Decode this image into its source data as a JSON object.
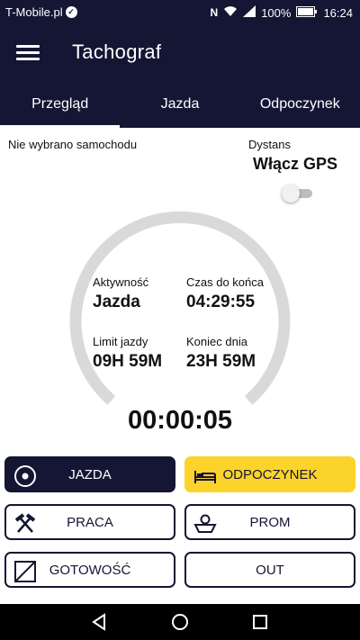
{
  "status_bar": {
    "carrier": "T-Mobile.pl",
    "battery": "100%",
    "time": "16:24"
  },
  "app": {
    "title": "Tachograf"
  },
  "tabs": [
    {
      "label": "Przegląd",
      "active": true
    },
    {
      "label": "Jazda",
      "active": false
    },
    {
      "label": "Odpoczynek",
      "active": false
    }
  ],
  "overview": {
    "vehicle_status": "Nie wybrano samochodu",
    "distance_label": "Dystans",
    "gps_label": "Włącz GPS",
    "gps_enabled": false
  },
  "stats": {
    "activity_label": "Aktywność",
    "activity_value": "Jazda",
    "remaining_label": "Czas do końca",
    "remaining_value": "04:29:55",
    "drive_limit_label": "Limit jazdy",
    "drive_limit_value": "09H 59M",
    "day_end_label": "Koniec dnia",
    "day_end_value": "23H 59M",
    "timer": "00:00:05"
  },
  "actions": {
    "drive": "JAZDA",
    "rest": "ODPOCZYNEK",
    "work": "PRACA",
    "ferry": "PROM",
    "available": "GOTOWOŚĆ",
    "out": "OUT"
  },
  "colors": {
    "primary": "#141634",
    "accent": "#fcd32a",
    "ring": "#d9d9d9"
  }
}
